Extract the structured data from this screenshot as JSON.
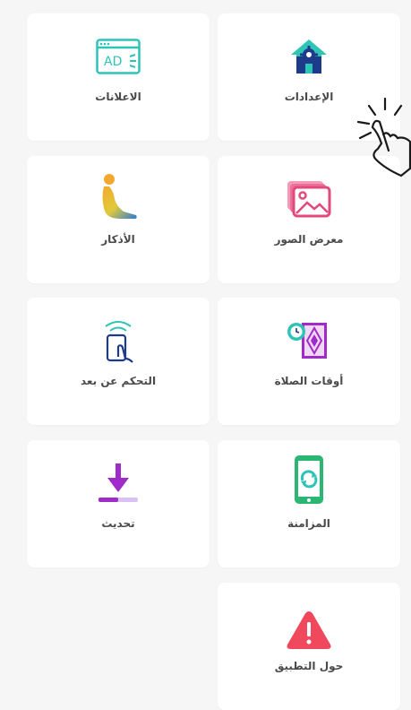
{
  "menu": {
    "ads": {
      "label": "الاعلانات",
      "icon": "ads-browser-icon"
    },
    "settings": {
      "label": "الإعدادات",
      "icon": "home-gear-icon"
    },
    "azkar": {
      "label": "الأذكار",
      "icon": "praying-person-icon"
    },
    "gallery": {
      "label": "معرض الصور",
      "icon": "image-gallery-icon"
    },
    "remote": {
      "label": "التحكم عن بعد",
      "icon": "remote-touch-icon"
    },
    "prayer_times": {
      "label": "أوقات الصلاة",
      "icon": "prayer-rug-clock-icon"
    },
    "update": {
      "label": "تحديث",
      "icon": "download-arrow-icon"
    },
    "sync": {
      "label": "المزامنة",
      "icon": "phone-sync-icon"
    },
    "about": {
      "label": "حول التطبيق",
      "icon": "warning-triangle-icon"
    }
  },
  "colors": {
    "background": "#f6f6f6",
    "card": "#ffffff",
    "label": "#4a4a4a",
    "teal": "#2ec4b6",
    "navy": "#1e3a8a",
    "pink": "#e24a7e",
    "purple": "#a02bc9",
    "green": "#2bb673",
    "red": "#f0485c"
  },
  "hint_icon": "tap-gesture-icon"
}
